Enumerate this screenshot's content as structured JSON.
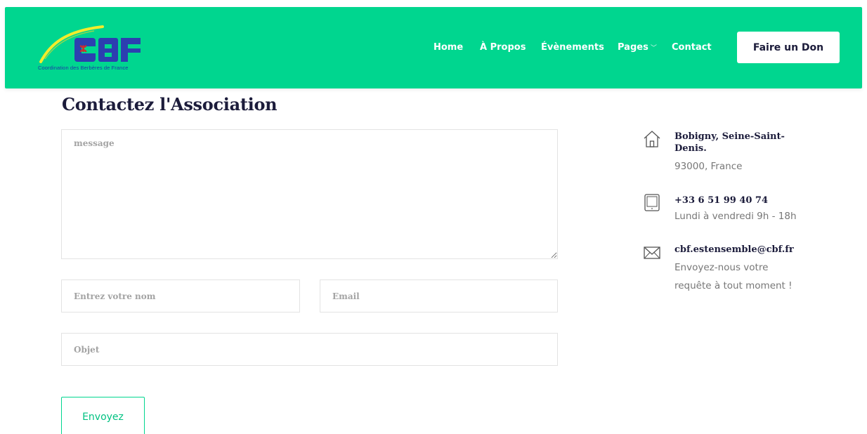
{
  "brand": {
    "logo_text": "CBF",
    "caption": "Coordination des Berbères de France",
    "colors": {
      "header_bg": "#00d68f",
      "logo_blue": "#2c3fb0",
      "logo_yellow": "#f2ec2b",
      "logo_red": "#d42a2a",
      "title": "#1c1c3b"
    }
  },
  "nav": {
    "items": [
      {
        "label": "Home"
      },
      {
        "label": "À Propos"
      },
      {
        "label": "Évènements"
      },
      {
        "label": "Pages",
        "caret": "﹀"
      },
      {
        "label": "Contact"
      }
    ],
    "donate_label": "Faire un Don"
  },
  "form": {
    "title": "Contactez l'Association",
    "message_placeholder": "message",
    "name_placeholder": "Entrez votre nom",
    "email_placeholder": "Email",
    "subject_placeholder": "Objet",
    "submit_label": "Envoyez"
  },
  "contact_info": {
    "address": {
      "icon": "home-icon",
      "heading": "Bobigny, Seine-Saint-Denis.",
      "sub": "93000, France"
    },
    "phone": {
      "icon": "tablet-icon",
      "heading": "+33 6 51 99 40 74",
      "sub": "Lundi à vendredi 9h - 18h"
    },
    "email": {
      "icon": "envelope-icon",
      "heading": "cbf.estensemble@cbf.fr",
      "sub": "Envoyez-nous votre requête à tout moment !"
    }
  }
}
